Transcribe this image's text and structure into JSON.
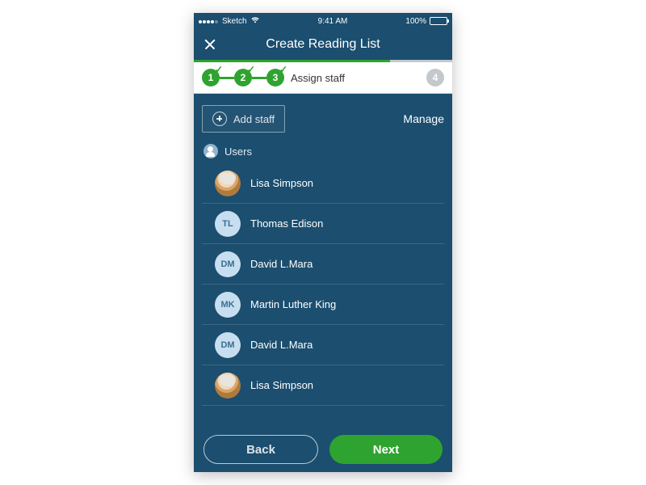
{
  "statusbar": {
    "carrier": "Sketch",
    "time": "9:41 AM",
    "battery_pct": "100%"
  },
  "nav": {
    "title": "Create Reading List"
  },
  "stepper": {
    "steps": [
      {
        "num": "1",
        "done": true
      },
      {
        "num": "2",
        "done": true
      },
      {
        "num": "3",
        "done": true
      },
      {
        "num": "4",
        "done": false
      }
    ],
    "active_label": "Assign staff"
  },
  "actions": {
    "add_staff": "Add staff",
    "manage": "Manage"
  },
  "section_title": "Users",
  "users": [
    {
      "name": "Lisa Simpson",
      "initials": "",
      "photo": true
    },
    {
      "name": "Thomas Edison",
      "initials": "TL",
      "photo": false
    },
    {
      "name": "David L.Mara",
      "initials": "DM",
      "photo": false
    },
    {
      "name": "Martin Luther King",
      "initials": "MK",
      "photo": false
    },
    {
      "name": "David L.Mara",
      "initials": "DM",
      "photo": false
    },
    {
      "name": "Lisa Simpson",
      "initials": "",
      "photo": true
    }
  ],
  "footer": {
    "back": "Back",
    "next": "Next"
  }
}
